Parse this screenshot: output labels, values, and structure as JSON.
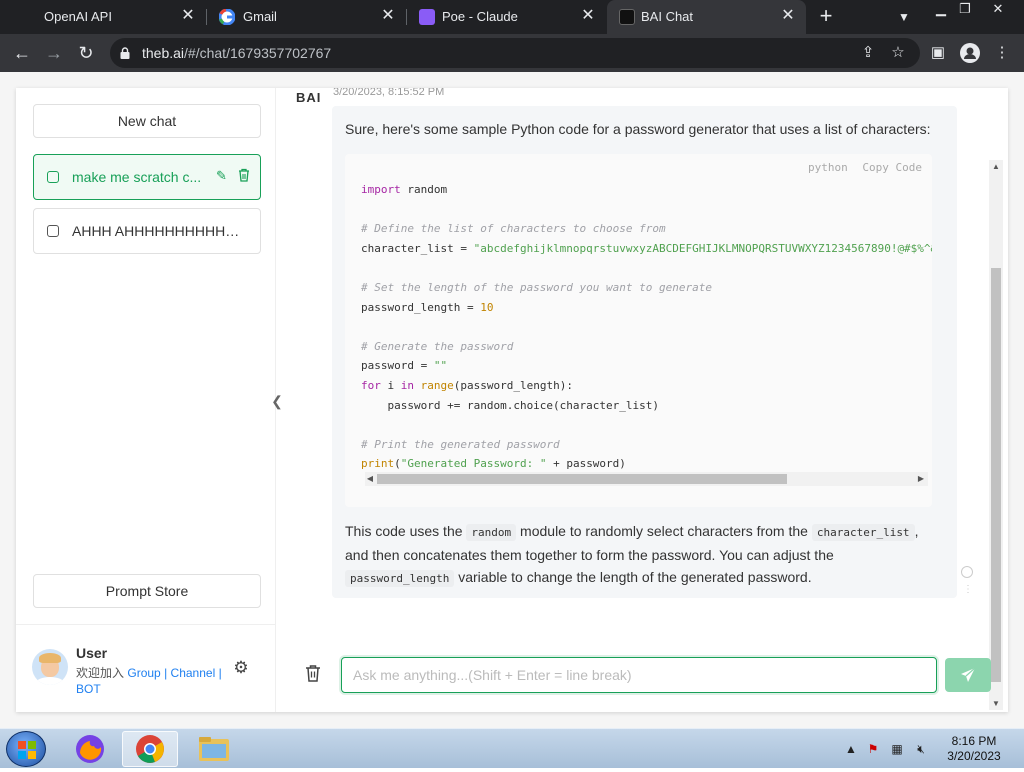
{
  "browser": {
    "tabs": [
      {
        "title": "OpenAI API",
        "active": false
      },
      {
        "title": "Gmail",
        "active": false
      },
      {
        "title": "Poe - Claude",
        "active": false
      },
      {
        "title": "BAI Chat",
        "active": true
      }
    ],
    "url_host": "theb.ai",
    "url_path": "/#/chat/1679357702767"
  },
  "sidebar": {
    "new_chat_label": "New chat",
    "conversations": [
      {
        "title": "make me scratch c...",
        "active": true
      },
      {
        "title": "AHHH AHHHHHHHHHHHH...",
        "active": false
      }
    ],
    "prompt_store_label": "Prompt Store",
    "user": {
      "name": "User",
      "join_text": "欢迎加入",
      "group_link": "Group",
      "sep1": "|",
      "channel_link": "Channel",
      "sep2": "|",
      "bot_link": "BOT"
    }
  },
  "chat": {
    "bot_name": "BAI",
    "timestamp": "3/20/2023, 8:15:52 PM",
    "intro": "Sure, here's some sample Python code for a password generator that uses a list of characters:",
    "code_lang": "python",
    "code_copy": "Copy Code",
    "code_lines": [
      {
        "parts": [
          {
            "t": "import",
            "c": "kw"
          },
          {
            "t": " random",
            "c": ""
          }
        ]
      },
      {
        "parts": []
      },
      {
        "parts": [
          {
            "t": "# Define the list of characters to choose from",
            "c": "cm"
          }
        ]
      },
      {
        "parts": [
          {
            "t": "character_list = ",
            "c": ""
          },
          {
            "t": "\"abcdefghijklmnopqrstuvwxyzABCDEFGHIJKLMNOPQRSTUVWXYZ1234567890!@#$%^&",
            "c": "st"
          }
        ]
      },
      {
        "parts": []
      },
      {
        "parts": [
          {
            "t": "# Set the length of the password you want to generate",
            "c": "cm"
          }
        ]
      },
      {
        "parts": [
          {
            "t": "password_length = ",
            "c": ""
          },
          {
            "t": "10",
            "c": "nm"
          }
        ]
      },
      {
        "parts": []
      },
      {
        "parts": [
          {
            "t": "# Generate the password",
            "c": "cm"
          }
        ]
      },
      {
        "parts": [
          {
            "t": "password = ",
            "c": ""
          },
          {
            "t": "\"\"",
            "c": "st"
          }
        ]
      },
      {
        "parts": [
          {
            "t": "for",
            "c": "kw"
          },
          {
            "t": " i ",
            "c": ""
          },
          {
            "t": "in",
            "c": "kw"
          },
          {
            "t": " ",
            "c": ""
          },
          {
            "t": "range",
            "c": "bi"
          },
          {
            "t": "(password_length):",
            "c": ""
          }
        ]
      },
      {
        "parts": [
          {
            "t": "    password += random.choice(character_list)",
            "c": ""
          }
        ]
      },
      {
        "parts": []
      },
      {
        "parts": [
          {
            "t": "# Print the generated password",
            "c": "cm"
          }
        ]
      },
      {
        "parts": [
          {
            "t": "print",
            "c": "bi"
          },
          {
            "t": "(",
            "c": ""
          },
          {
            "t": "\"Generated Password: \"",
            "c": "st"
          },
          {
            "t": " + password)",
            "c": ""
          }
        ]
      }
    ],
    "outro_1": "This code uses the",
    "outro_code_1": "random",
    "outro_2": "module to randomly select characters from the",
    "outro_code_2": "character_list",
    "outro_3": ", and then concatenates them together to form the password. You can adjust the",
    "outro_code_3": "password_length",
    "outro_4": "variable to change the length of the generated password."
  },
  "composer": {
    "placeholder": "Ask me anything...(Shift + Enter = line break)"
  },
  "taskbar": {
    "time": "8:16 PM",
    "date": "3/20/2023"
  },
  "colors": {
    "accent": "#18a058",
    "send_disabled": "#8cd5ae",
    "browser_dark": "#202124",
    "toolbar": "#35363a"
  },
  "icons": [
    "chevron-down-icon",
    "close-icon",
    "plus-icon",
    "back-icon",
    "forward-icon",
    "reload-icon",
    "lock-icon",
    "share-icon",
    "star-icon",
    "sidebar-icon",
    "profile-icon",
    "menu-icon",
    "chat-icon",
    "edit-icon",
    "trash-icon",
    "gear-icon",
    "send-icon",
    "chevron-left-icon"
  ]
}
